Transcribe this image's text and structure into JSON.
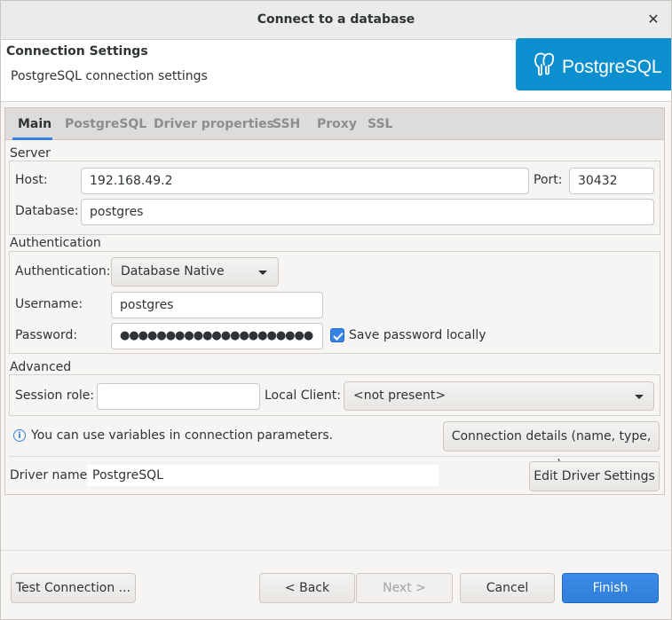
{
  "window": {
    "title": "Connect to a database"
  },
  "header": {
    "title": "Connection Settings",
    "subtitle": "PostgreSQL connection settings",
    "logo_text": "PostgreSQL"
  },
  "tabs": [
    {
      "label": "Main"
    },
    {
      "label": "PostgreSQL"
    },
    {
      "label": "Driver properties"
    },
    {
      "label": "SSH"
    },
    {
      "label": "Proxy"
    },
    {
      "label": "SSL"
    }
  ],
  "server": {
    "group_label": "Server",
    "host_label": "Host:",
    "host_value": "192.168.49.2",
    "port_label": "Port:",
    "port_value": "30432",
    "database_label": "Database:",
    "database_value": "postgres"
  },
  "auth": {
    "group_label": "Authentication",
    "auth_label": "Authentication:",
    "auth_value": "Database Native",
    "username_label": "Username:",
    "username_value": "postgres",
    "password_label": "Password:",
    "password_value": "●●●●●●●●●●●●●●●●●●●●●",
    "save_password_label": "Save password locally",
    "save_password_checked": true
  },
  "advanced": {
    "group_label": "Advanced",
    "session_role_label": "Session role:",
    "session_role_value": "",
    "local_client_label": "Local Client:",
    "local_client_value": "<not present>"
  },
  "info": {
    "text": "You can use variables in connection parameters.",
    "details_button": "Connection details (name, type, ... )"
  },
  "driver": {
    "label": "Driver name:",
    "value": "PostgreSQL",
    "edit_button": "Edit Driver Settings"
  },
  "footer": {
    "test_button": "Test Connection ...",
    "back_button": "< Back",
    "next_button": "Next >",
    "cancel_button": "Cancel",
    "finish_button": "Finish"
  },
  "colors": {
    "accent": "#3584e4",
    "logo_bg": "#0c8fce",
    "window_bg": "#f6f5f4"
  }
}
